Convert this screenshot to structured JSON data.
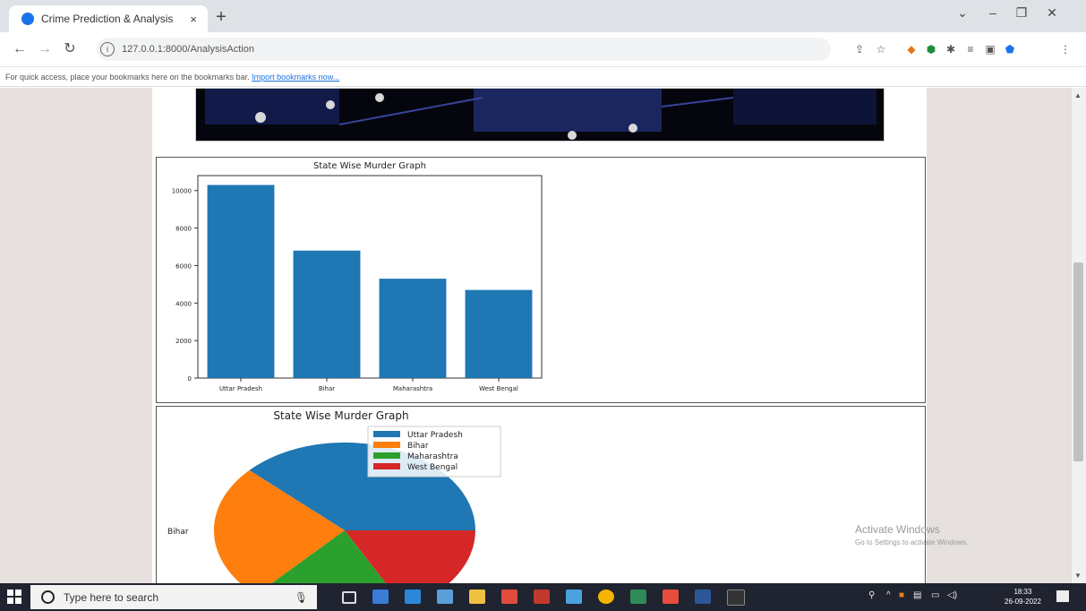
{
  "browser": {
    "tab_title": "Crime Prediction & Analysis",
    "tab_close": "×",
    "new_tab": "+",
    "url": "127.0.0.1:8000/AnalysisAction",
    "bookmarks_text": "For quick access, place your bookmarks here on the bookmarks bar.",
    "bookmarks_link": "Import bookmarks now..."
  },
  "bar_chart": {
    "title": "State Wise Murder Graph",
    "chart_data": {
      "type": "bar",
      "title": "State Wise Murder Graph",
      "categories": [
        "Uttar Pradesh",
        "Bihar",
        "Maharashtra",
        "West Bengal"
      ],
      "values": [
        10300,
        6800,
        5300,
        4700
      ],
      "ylim": [
        0,
        10800
      ],
      "yticks": [
        0,
        2000,
        4000,
        6000,
        8000,
        10000
      ],
      "color": "#1f77b4"
    }
  },
  "pie_chart": {
    "title": "State Wise Murder Graph",
    "label_bihar": "Bihar",
    "label_west_bengal": "West Bengal",
    "chart_data": {
      "type": "pie",
      "title": "State Wise Murder Graph",
      "labels": [
        "Uttar Pradesh",
        "Bihar",
        "Maharashtra",
        "West Bengal"
      ],
      "values": [
        10300,
        6800,
        5300,
        4700
      ],
      "colors": [
        "#1f77b4",
        "#ff7f0e",
        "#2ca02c",
        "#d62728"
      ]
    }
  },
  "watermark": {
    "line1": "Activate Windows",
    "line2": "Go to Settings to activate Windows."
  },
  "taskbar": {
    "search_placeholder": "Type here to search",
    "time": "18:33",
    "date": "26-09-2022"
  }
}
